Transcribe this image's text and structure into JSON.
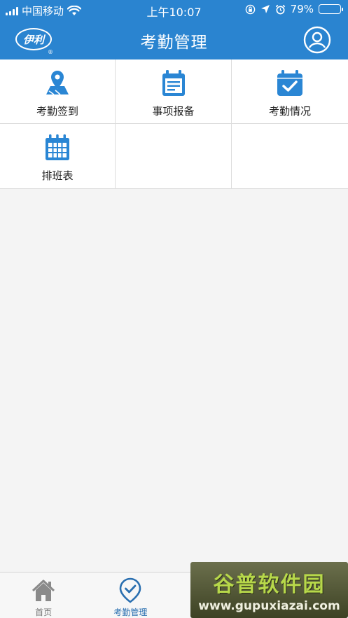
{
  "status_bar": {
    "carrier": "中国移动",
    "time": "上午10:07",
    "battery_percent": "79%",
    "battery_level": 0.79,
    "icons": [
      "signal-icon",
      "wifi-icon",
      "rotation-lock-icon",
      "location-icon",
      "alarm-icon",
      "battery-icon"
    ]
  },
  "header": {
    "title": "考勤管理",
    "logo_text": "伊利",
    "logo_mark": "®",
    "user_icon": "user-icon"
  },
  "grid": {
    "items": [
      {
        "label": "考勤签到",
        "icon": "map-pin-icon"
      },
      {
        "label": "事项报备",
        "icon": "calendar-note-icon"
      },
      {
        "label": "考勤情况",
        "icon": "calendar-check-icon"
      },
      {
        "label": "排班表",
        "icon": "calendar-grid-icon"
      }
    ]
  },
  "tabbar": {
    "tabs": [
      {
        "label": "首页",
        "icon": "home-icon",
        "active": false
      },
      {
        "label": "考勤管理",
        "icon": "check-pin-icon",
        "active": true
      }
    ]
  },
  "watermark": {
    "title": "谷普软件园",
    "url": "www.gupuxiazai.com"
  },
  "colors": {
    "primary": "#2a84d0",
    "icon_blue": "#2a86d4",
    "tab_active": "#2a6fb0",
    "background": "#f4f4f4"
  }
}
